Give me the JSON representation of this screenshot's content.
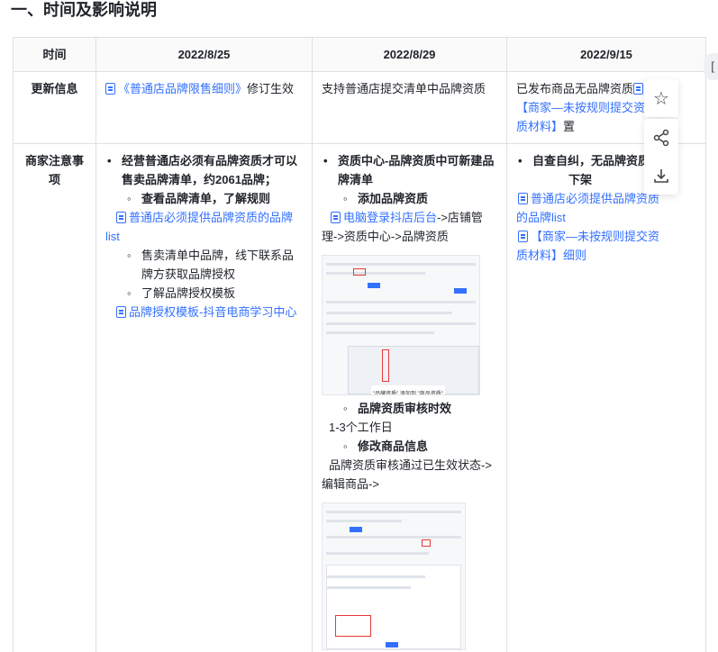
{
  "title": "一、时间及影响说明",
  "table": {
    "headers": [
      "时间",
      "2022/8/25",
      "2022/8/29",
      "2022/9/15"
    ],
    "row1": {
      "label": "更新信息",
      "c1_link": "《普通店品牌限售细则》",
      "c1_text": "修订生效",
      "c2_text": "支持普通店提交清单中品牌资质",
      "c3_text": "已发布商品无品牌资质",
      "c3_link": "【商家—未按规则提交资质材料】",
      "c3_tail": "置"
    },
    "row2": {
      "label": "商家注意事项",
      "c1": {
        "b1": "经营普通店必须有品牌资质才可以售卖品牌清单，约2061品牌；",
        "b1a": "查看品牌清单，了解规则",
        "link1": "普通店必须提供品牌资质的品牌list",
        "b1b": "售卖清单中品牌，线下联系品牌方获取品牌授权",
        "b1c": "了解品牌授权模板",
        "link2": "品牌授权模板-抖音电商学习中心"
      },
      "c2": {
        "b1": "资质中心-品牌资质中可新建品牌清单",
        "sub1": "添加品牌资质",
        "link1": "电脑登录抖店后台",
        "text1": "->店铺管理->资质中心->品牌资质",
        "sub2": "品牌资质审核时效",
        "text2": "1-3个工作日",
        "sub3": "修改商品信息",
        "text3": "品牌资质审核通过已生效状态->编辑商品->",
        "shot_caption": "\"品牌资质\" 添加到 \"商品资质\""
      },
      "c3": {
        "b1": "自查自纠，无品牌资质",
        "b1_tail": "下架",
        "link1": "普通店必须提供品牌资质的品牌list",
        "link2": "【商家—未按规则提交资质材料】细则"
      }
    }
  },
  "float_icons": [
    "star-icon",
    "share-icon",
    "download-icon"
  ],
  "colors": {
    "link": "#3370ff",
    "border": "#dee0e3",
    "text": "#1f2329"
  }
}
